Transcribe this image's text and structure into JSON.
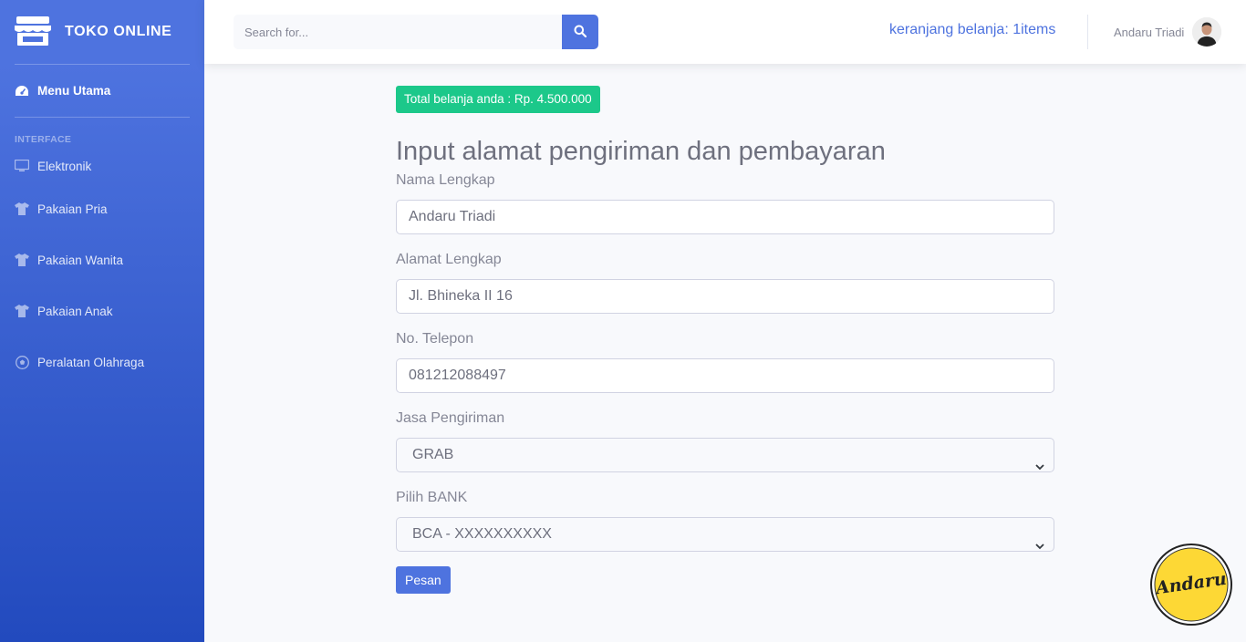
{
  "sidebar": {
    "brand": "TOKO ONLINE",
    "dashboard": "Menu Utama",
    "heading": "INTERFACE",
    "items": [
      {
        "label": "Elektronik",
        "icon": "desktop-icon"
      },
      {
        "label": "Pakaian Pria",
        "icon": "shirt-icon"
      },
      {
        "label": "Pakaian Wanita",
        "icon": "shirt-icon"
      },
      {
        "label": "Pakaian Anak",
        "icon": "shirt-icon"
      },
      {
        "label": "Peralatan Olahraga",
        "icon": "football-icon"
      }
    ]
  },
  "topbar": {
    "search_placeholder": "Search for...",
    "cart": "keranjang belanja: 1items",
    "user_name": "Andaru Triadi"
  },
  "main": {
    "total": "Total belanja anda : Rp. 4.500.000",
    "title": "Input alamat pengiriman dan pembayaran",
    "fields": {
      "nama_label": "Nama Lengkap",
      "nama_value": "Andaru Triadi",
      "alamat_label": "Alamat Lengkap",
      "alamat_value": "Jl. Bhineka II 16",
      "telepon_label": "No. Telepon",
      "telepon_value": "081212088497",
      "jasa_label": "Jasa Pengiriman",
      "jasa_value": "GRAB",
      "bank_label": "Pilih BANK",
      "bank_value": "BCA - XXXXXXXXXX"
    },
    "submit": "Pesan"
  },
  "watermark": "Andaru",
  "colors": {
    "primary": "#4e73df",
    "success": "#1cc88a",
    "watermark_fill": "#fdd835"
  }
}
